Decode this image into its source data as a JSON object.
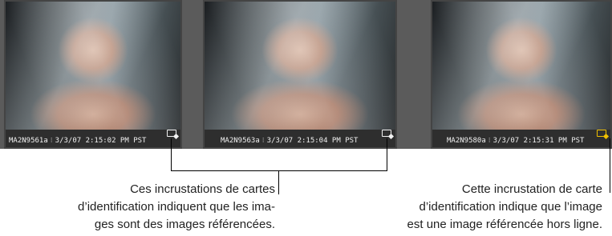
{
  "thumbnails": [
    {
      "filename": "MA2N9561a",
      "date": "3/3/07 2:15:02 PM PST",
      "badge": "referenced-image-icon"
    },
    {
      "filename": "MA2N9563a",
      "date": "3/3/07 2:15:04 PM PST",
      "badge": "referenced-image-icon"
    },
    {
      "filename": "MA2N9580a",
      "date": "3/3/07 2:15:31 PM PST",
      "badge": "offline-referenced-image-icon"
    }
  ],
  "callouts": {
    "left": "Ces incrustations de cartes\nd’identification indiquent que les ima-\nges sont des images référencées.",
    "right": "Cette incrustation de carte\nd’identification indique que l’image\nest une image référencée hors ligne."
  },
  "colors": {
    "offline_badge": "#f0c000",
    "caption_bar": "#2e2e2e",
    "strip": "#5b5b5b"
  }
}
